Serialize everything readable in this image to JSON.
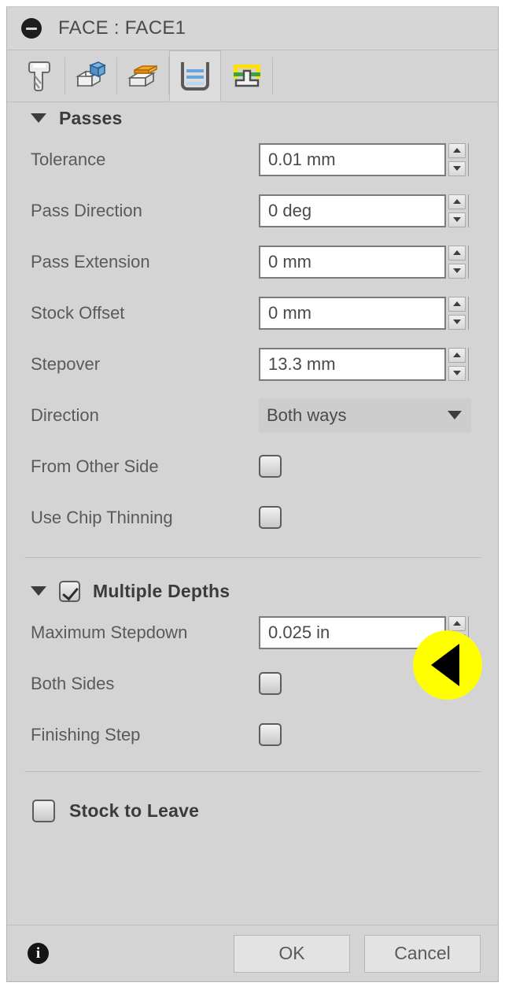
{
  "dialog": {
    "title": "FACE : FACE1",
    "collapse_icon": "minus-circle-icon"
  },
  "tabs": [
    {
      "name": "tool",
      "icon": "endmill-tool-icon",
      "selected": false
    },
    {
      "name": "geometry",
      "icon": "geometry-cube-icon",
      "selected": false
    },
    {
      "name": "heights",
      "icon": "heights-cube-icon",
      "selected": false
    },
    {
      "name": "passes",
      "icon": "passes-pocket-icon",
      "selected": true
    },
    {
      "name": "linking",
      "icon": "linking-ramp-icon",
      "selected": false
    }
  ],
  "passes": {
    "header": "Passes",
    "rows": [
      {
        "label": "Tolerance",
        "value": "0.01 mm",
        "type": "spinbox"
      },
      {
        "label": "Pass Direction",
        "value": "0 deg",
        "type": "spinbox"
      },
      {
        "label": "Pass Extension",
        "value": "0 mm",
        "type": "spinbox"
      },
      {
        "label": "Stock Offset",
        "value": "0 mm",
        "type": "spinbox"
      },
      {
        "label": "Stepover",
        "value": "13.3 mm",
        "type": "spinbox"
      },
      {
        "label": "Direction",
        "value": "Both ways",
        "type": "combobox"
      },
      {
        "label": "From Other Side",
        "value": false,
        "type": "checkbox"
      },
      {
        "label": "Use Chip Thinning",
        "value": false,
        "type": "checkbox"
      }
    ]
  },
  "multiple_depths": {
    "header": "Multiple Depths",
    "checked": true,
    "rows": [
      {
        "label": "Maximum Stepdown",
        "value": "0.025 in",
        "type": "spinbox"
      },
      {
        "label": "Both Sides",
        "value": false,
        "type": "checkbox"
      },
      {
        "label": "Finishing Step",
        "value": false,
        "type": "checkbox"
      }
    ]
  },
  "stock_to_leave": {
    "header": "Stock to Leave",
    "checked": false
  },
  "footer": {
    "info_icon": "info-circle-icon",
    "ok_label": "OK",
    "cancel_label": "Cancel"
  },
  "annotation": {
    "icon": "left-pointing-triangle-marker",
    "circle_color": "#ffff00",
    "arrow_color": "#000000"
  }
}
